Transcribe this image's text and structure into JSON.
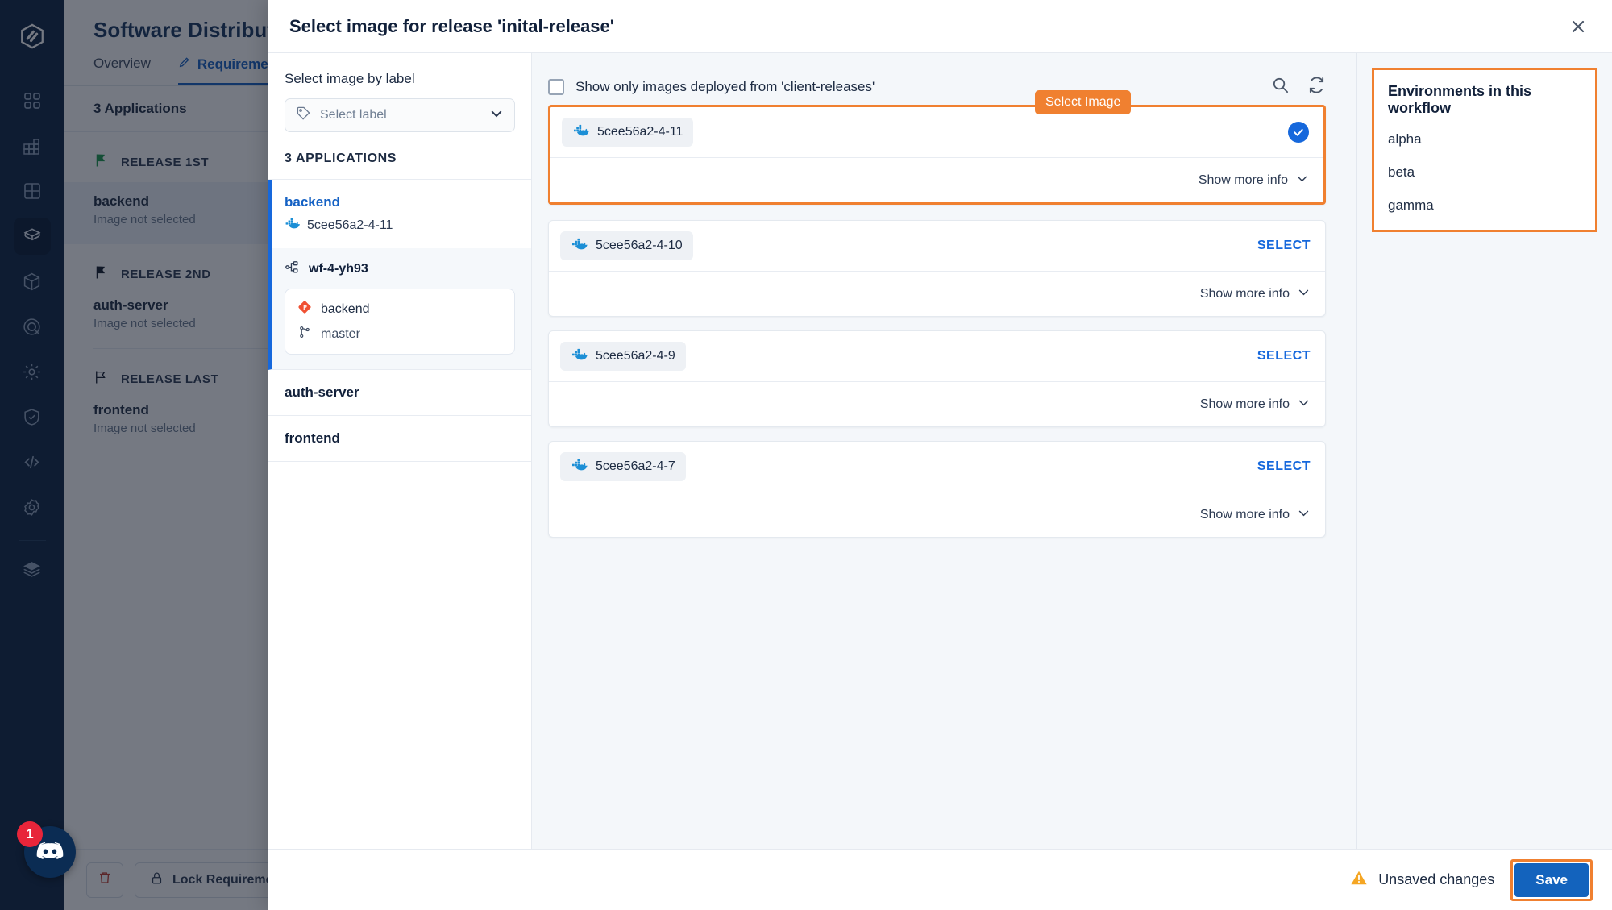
{
  "background": {
    "title": "Software Distribution",
    "tabs": [
      {
        "label": "Overview",
        "active": false
      },
      {
        "label": "Requirements",
        "active": true,
        "icon": "pencil-icon"
      }
    ],
    "subbar": {
      "app_count": "3 Applications",
      "sort_icon": "sort-icon"
    },
    "groups": [
      {
        "name": "RELEASE 1ST",
        "flag_color": "#1a9a4b",
        "items": [
          {
            "name": "backend",
            "status": "Image not selected",
            "selected": true
          }
        ]
      },
      {
        "name": "RELEASE 2ND",
        "flag_color": "#101828",
        "items": [
          {
            "name": "auth-server",
            "status": "Image not selected",
            "selected": false
          }
        ]
      },
      {
        "name": "RELEASE LAST",
        "flag_color": "#101828",
        "items": [
          {
            "name": "frontend",
            "status": "Image not selected",
            "selected": false
          }
        ]
      }
    ],
    "footer": {
      "delete_icon": "trash-icon",
      "lock_label": "Lock Requirements",
      "lock_icon": "lock-icon"
    },
    "nav_icons": [
      "logo-icon",
      "apps-grid-icon",
      "blocks-icon",
      "dashboard-grid-icon",
      "package-layers-icon",
      "cube-icon",
      "target-icon",
      "gear-sun-icon",
      "shield-check-icon",
      "code-icon",
      "settings-gear-icon",
      "stack-icon"
    ],
    "discord": {
      "icon": "discord-icon",
      "badge": "1"
    }
  },
  "modal": {
    "title": "Select image for release 'inital-release'",
    "close_icon": "close-icon",
    "left": {
      "label_heading": "Select image by label",
      "label_select": {
        "placeholder": "Select label",
        "tag_icon": "tag-icon",
        "chevron_icon": "chevron-down-icon"
      },
      "apps_heading": "3 APPLICATIONS",
      "apps": [
        {
          "name": "backend",
          "active": true,
          "image": "5cee56a2-4-11",
          "image_icon": "docker-icon"
        },
        {
          "name": "auth-server",
          "active": false
        },
        {
          "name": "frontend",
          "active": false
        }
      ],
      "workflow": {
        "name": "wf-4-yh93",
        "icon": "workflow-nodes-icon",
        "repo": "backend",
        "repo_icon": "git-repo-icon",
        "branch": "master",
        "branch_icon": "git-branch-icon"
      }
    },
    "center": {
      "filter_label": "Show only images deployed from 'client-releases'",
      "filter_checked": false,
      "search_icon": "search-icon",
      "refresh_icon": "refresh-icon",
      "tooltip": "Select Image",
      "show_more_label": "Show more info",
      "show_more_icon": "chevron-down-icon",
      "select_label": "SELECT",
      "images": [
        {
          "tag": "5cee56a2-4-11",
          "icon": "docker-icon",
          "selected": true
        },
        {
          "tag": "5cee56a2-4-10",
          "icon": "docker-icon",
          "selected": false
        },
        {
          "tag": "5cee56a2-4-9",
          "icon": "docker-icon",
          "selected": false
        },
        {
          "tag": "5cee56a2-4-7",
          "icon": "docker-icon",
          "selected": false
        }
      ]
    },
    "right": {
      "title": "Environments in this workflow",
      "environments": [
        "alpha",
        "beta",
        "gamma"
      ]
    },
    "footer": {
      "unsaved_label": "Unsaved changes",
      "warning_icon": "warning-triangle-icon",
      "save_label": "Save"
    }
  },
  "colors": {
    "accent_orange": "#F08030",
    "accent_blue": "#1668DC",
    "save_blue": "#1363bd",
    "nav_dark": "#0A2240"
  }
}
